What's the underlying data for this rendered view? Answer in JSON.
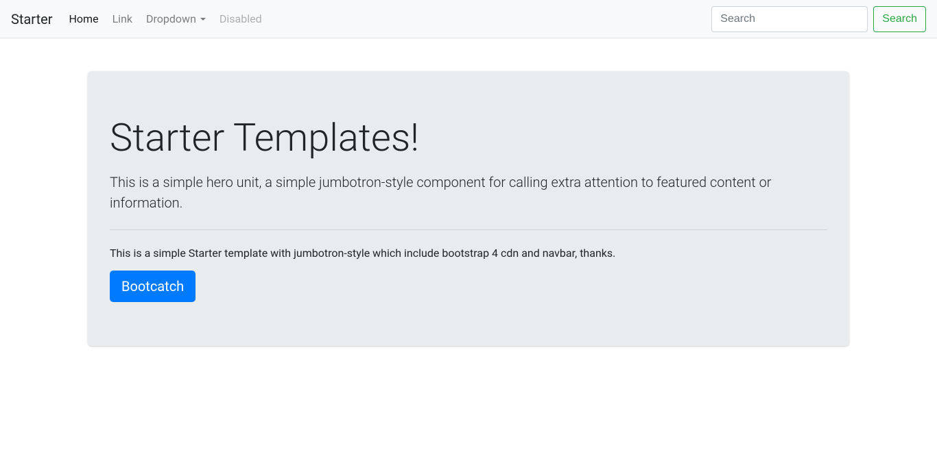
{
  "navbar": {
    "brand": "Starter",
    "items": [
      {
        "label": "Home",
        "active": true
      },
      {
        "label": "Link"
      },
      {
        "label": "Dropdown"
      },
      {
        "label": "Disabled",
        "disabled": true
      }
    ],
    "search": {
      "placeholder": "Search",
      "button_label": "Search"
    }
  },
  "jumbotron": {
    "title": "Starter Templates!",
    "lead": "This is a simple hero unit, a simple jumbotron-style component for calling extra attention to featured content or information.",
    "text": "This is a simple Starter template with jumbotron-style which include bootstrap 4 cdn and navbar, thanks.",
    "button_label": "Bootcatch"
  }
}
